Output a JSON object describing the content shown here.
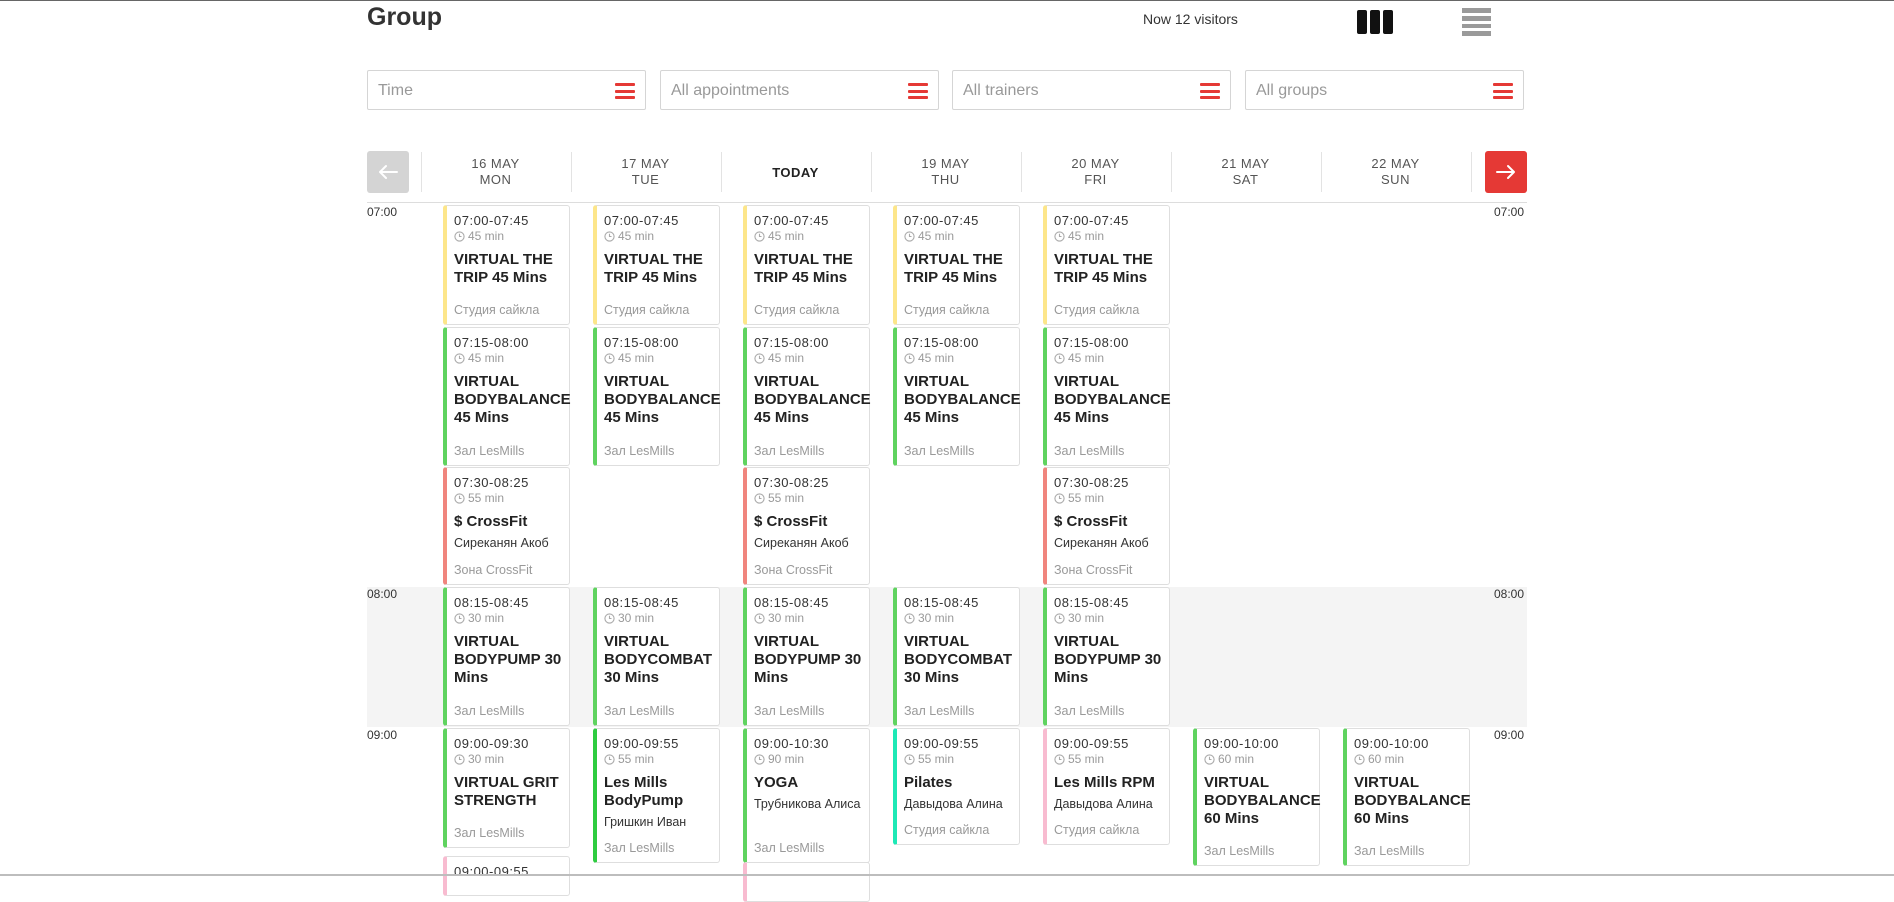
{
  "header": {
    "title": "Group",
    "visitors": "Now 12 visitors",
    "view_grid_icon": "columns-view-icon",
    "view_list_icon": "list-view-icon"
  },
  "filters": [
    {
      "placeholder": "Time",
      "icon": "menu-icon"
    },
    {
      "placeholder": "All appointments",
      "icon": "menu-icon"
    },
    {
      "placeholder": "All trainers",
      "icon": "menu-icon"
    },
    {
      "placeholder": "All groups",
      "icon": "menu-icon"
    }
  ],
  "nav": {
    "prev_icon": "arrow-left-icon",
    "next_icon": "arrow-right-icon"
  },
  "days": [
    {
      "date": "16 MAY",
      "weekday": "MON"
    },
    {
      "date": "17 MAY",
      "weekday": "TUE"
    },
    {
      "date": "TODAY",
      "weekday": ""
    },
    {
      "date": "19 MAY",
      "weekday": "THU"
    },
    {
      "date": "20 MAY",
      "weekday": "FRI"
    },
    {
      "date": "21 MAY",
      "weekday": "SAT"
    },
    {
      "date": "22 MAY",
      "weekday": "SUN"
    }
  ],
  "time_labels": [
    "07:00",
    "08:00",
    "09:00"
  ],
  "colors": {
    "accent": "#e53935",
    "yellow": "#fde68a",
    "green": "#5fd35f",
    "salmon": "#f0857d",
    "teal": "#1de9b6",
    "pink": "#f8bbd0",
    "gray_band": "#f4f4f4"
  },
  "classes": [
    {
      "day": 0,
      "time": "07:00-07:45",
      "duration": "45 min",
      "name": "VIRTUAL THE TRIP 45 Mins",
      "trainer": "",
      "room": "Студия сайкла",
      "color": "#fde68a"
    },
    {
      "day": 1,
      "time": "07:00-07:45",
      "duration": "45 min",
      "name": "VIRTUAL THE TRIP 45 Mins",
      "trainer": "",
      "room": "Студия сайкла",
      "color": "#fde68a"
    },
    {
      "day": 2,
      "time": "07:00-07:45",
      "duration": "45 min",
      "name": "VIRTUAL THE TRIP 45 Mins",
      "trainer": "",
      "room": "Студия сайкла",
      "color": "#fde68a"
    },
    {
      "day": 3,
      "time": "07:00-07:45",
      "duration": "45 min",
      "name": "VIRTUAL THE TRIP 45 Mins",
      "trainer": "",
      "room": "Студия сайкла",
      "color": "#fde68a"
    },
    {
      "day": 4,
      "time": "07:00-07:45",
      "duration": "45 min",
      "name": "VIRTUAL THE TRIP 45 Mins",
      "trainer": "",
      "room": "Студия сайкла",
      "color": "#fde68a"
    },
    {
      "day": 0,
      "time": "07:15-08:00",
      "duration": "45 min",
      "name": "VIRTUAL BODYBALANCE 45 Mins",
      "trainer": "",
      "room": "Зал LesMills",
      "color": "#5fd35f"
    },
    {
      "day": 1,
      "time": "07:15-08:00",
      "duration": "45 min",
      "name": "VIRTUAL BODYBALANCE 45 Mins",
      "trainer": "",
      "room": "Зал LesMills",
      "color": "#5fd35f"
    },
    {
      "day": 2,
      "time": "07:15-08:00",
      "duration": "45 min",
      "name": "VIRTUAL BODYBALANCE 45 Mins",
      "trainer": "",
      "room": "Зал LesMills",
      "color": "#5fd35f"
    },
    {
      "day": 3,
      "time": "07:15-08:00",
      "duration": "45 min",
      "name": "VIRTUAL BODYBALANCE 45 Mins",
      "trainer": "",
      "room": "Зал LesMills",
      "color": "#5fd35f"
    },
    {
      "day": 4,
      "time": "07:15-08:00",
      "duration": "45 min",
      "name": "VIRTUAL BODYBALANCE 45 Mins",
      "trainer": "",
      "room": "Зал LesMills",
      "color": "#5fd35f"
    },
    {
      "day": 0,
      "time": "07:30-08:25",
      "duration": "55 min",
      "name": "$ CrossFit",
      "trainer": "Сиреканян Акоб",
      "room": "Зона CrossFit",
      "color": "#f0857d"
    },
    {
      "day": 2,
      "time": "07:30-08:25",
      "duration": "55 min",
      "name": "$ CrossFit",
      "trainer": "Сиреканян Акоб",
      "room": "Зона CrossFit",
      "color": "#f0857d"
    },
    {
      "day": 4,
      "time": "07:30-08:25",
      "duration": "55 min",
      "name": "$ CrossFit",
      "trainer": "Сиреканян Акоб",
      "room": "Зона CrossFit",
      "color": "#f0857d"
    },
    {
      "day": 0,
      "time": "08:15-08:45",
      "duration": "30 min",
      "name": "VIRTUAL BODYPUMP 30 Mins",
      "trainer": "",
      "room": "Зал LesMills",
      "color": "#5fd35f"
    },
    {
      "day": 1,
      "time": "08:15-08:45",
      "duration": "30 min",
      "name": "VIRTUAL BODYCOMBAT 30 Mins",
      "trainer": "",
      "room": "Зал LesMills",
      "color": "#5fd35f"
    },
    {
      "day": 2,
      "time": "08:15-08:45",
      "duration": "30 min",
      "name": "VIRTUAL BODYPUMP 30 Mins",
      "trainer": "",
      "room": "Зал LesMills",
      "color": "#5fd35f"
    },
    {
      "day": 3,
      "time": "08:15-08:45",
      "duration": "30 min",
      "name": "VIRTUAL BODYCOMBAT 30 Mins",
      "trainer": "",
      "room": "Зал LesMills",
      "color": "#5fd35f"
    },
    {
      "day": 4,
      "time": "08:15-08:45",
      "duration": "30 min",
      "name": "VIRTUAL BODYPUMP 30 Mins",
      "trainer": "",
      "room": "Зал LesMills",
      "color": "#5fd35f"
    },
    {
      "day": 0,
      "time": "09:00-09:30",
      "duration": "30 min",
      "name": "VIRTUAL GRIT STRENGTH",
      "trainer": "",
      "room": "Зал LesMills",
      "color": "#5fd35f"
    },
    {
      "day": 1,
      "time": "09:00-09:55",
      "duration": "55 min",
      "name": "Les Mills BodyPump",
      "trainer": "Гришкин Иван",
      "room": "Зал LesMills",
      "color": "#2ecc40"
    },
    {
      "day": 2,
      "time": "09:00-10:30",
      "duration": "90 min",
      "name": "YOGA",
      "trainer": "Трубникова Алиса",
      "room": "Зал LesMills",
      "color": "#5fd35f"
    },
    {
      "day": 3,
      "time": "09:00-09:55",
      "duration": "55 min",
      "name": "Pilates",
      "trainer": "Давыдова Алина",
      "room": "Студия сайкла",
      "color": "#1de9b6"
    },
    {
      "day": 4,
      "time": "09:00-09:55",
      "duration": "55 min",
      "name": "Les Mills RPM",
      "trainer": "Давыдова Алина",
      "room": "Студия сайкла",
      "color": "#f8bbd0"
    },
    {
      "day": 5,
      "time": "09:00-10:00",
      "duration": "60 min",
      "name": "VIRTUAL BODYBALANCE 60 Mins",
      "trainer": "",
      "room": "Зал LesMills",
      "color": "#5fd35f"
    },
    {
      "day": 6,
      "time": "09:00-10:00",
      "duration": "60 min",
      "name": "VIRTUAL BODYBALANCE 60 Mins",
      "trainer": "",
      "room": "Зал LesMills",
      "color": "#5fd35f"
    },
    {
      "day": 0,
      "time": "09:00-09:55",
      "duration": "",
      "name": "",
      "trainer": "",
      "room": "",
      "color": "#f8bbd0"
    },
    {
      "day": 2,
      "time": "",
      "duration": "",
      "name": "",
      "trainer": "",
      "room": "",
      "color": "#f8bbd0"
    }
  ]
}
